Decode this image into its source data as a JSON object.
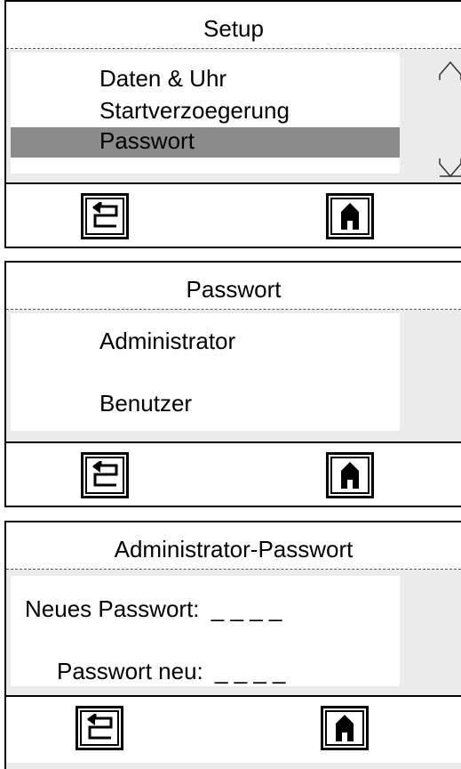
{
  "screens": [
    {
      "title": "Setup",
      "items": [
        "Daten & Uhr",
        "Startverzoegerung",
        "Passwort"
      ],
      "selected_index": 2
    },
    {
      "title": "Passwort",
      "items": [
        "Administrator",
        "Benutzer"
      ]
    },
    {
      "title": "Administrator-Passwort",
      "fields": [
        {
          "label": "Neues Passwort:",
          "value": "_ _ _ _"
        },
        {
          "label": "Passwort neu:",
          "value": "_ _ _ _"
        }
      ]
    }
  ],
  "icons": {
    "back": "back-arrow-icon",
    "home": "home-icon",
    "scroll_up": "scroll-up-arrow-icon",
    "scroll_down": "scroll-down-arrow-icon"
  }
}
